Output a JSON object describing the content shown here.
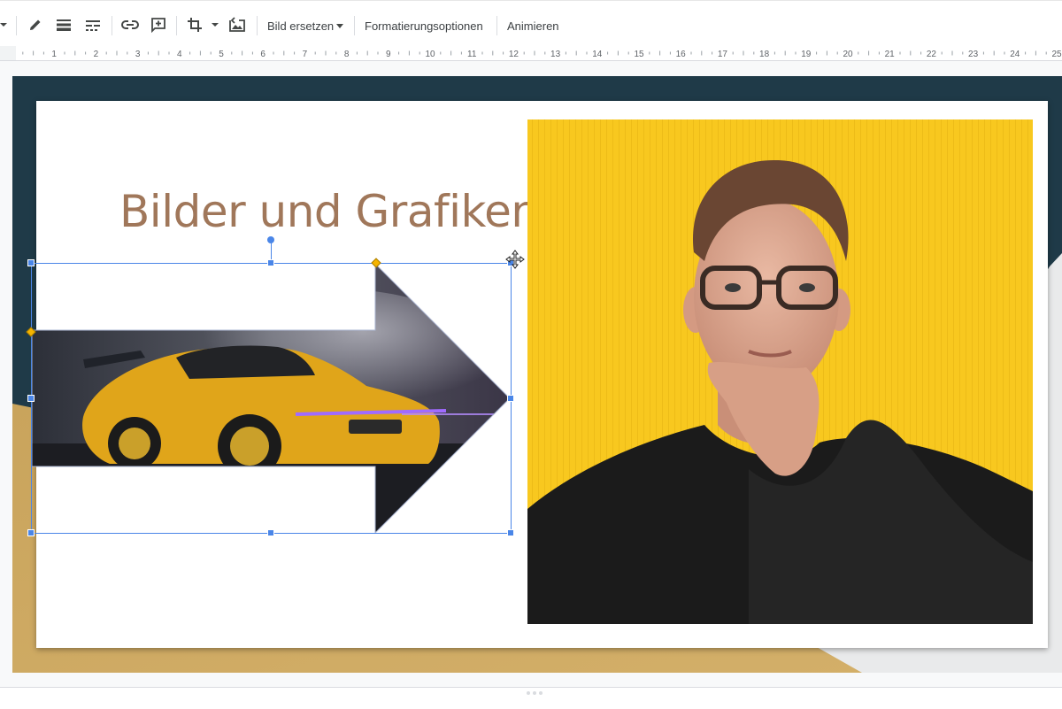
{
  "toolbar": {
    "replace_image_label": "Bild ersetzen",
    "format_options_label": "Formatierungsoptionen",
    "animate_label": "Animieren",
    "icons": [
      "dropdown-caret-icon",
      "pen-icon",
      "line-weight-icon",
      "line-dash-icon",
      "link-icon",
      "add-comment-icon",
      "crop-icon",
      "crop-dropdown-icon",
      "reset-image-icon"
    ]
  },
  "ruler": {
    "numbers": [
      "1",
      "2",
      "3",
      "4",
      "5",
      "6",
      "7",
      "8",
      "9",
      "10",
      "11",
      "12",
      "13",
      "14",
      "15",
      "16",
      "17",
      "18",
      "19",
      "20",
      "21",
      "22",
      "23",
      "24",
      "25"
    ]
  },
  "slide": {
    "title": "Bilder und Grafiken",
    "colors": {
      "title": "#a0775a",
      "theme_dark": "#1f3a48",
      "theme_gold": "#c9a45c",
      "selection": "#4a86e8",
      "photo_background": "#f8c81f"
    }
  }
}
